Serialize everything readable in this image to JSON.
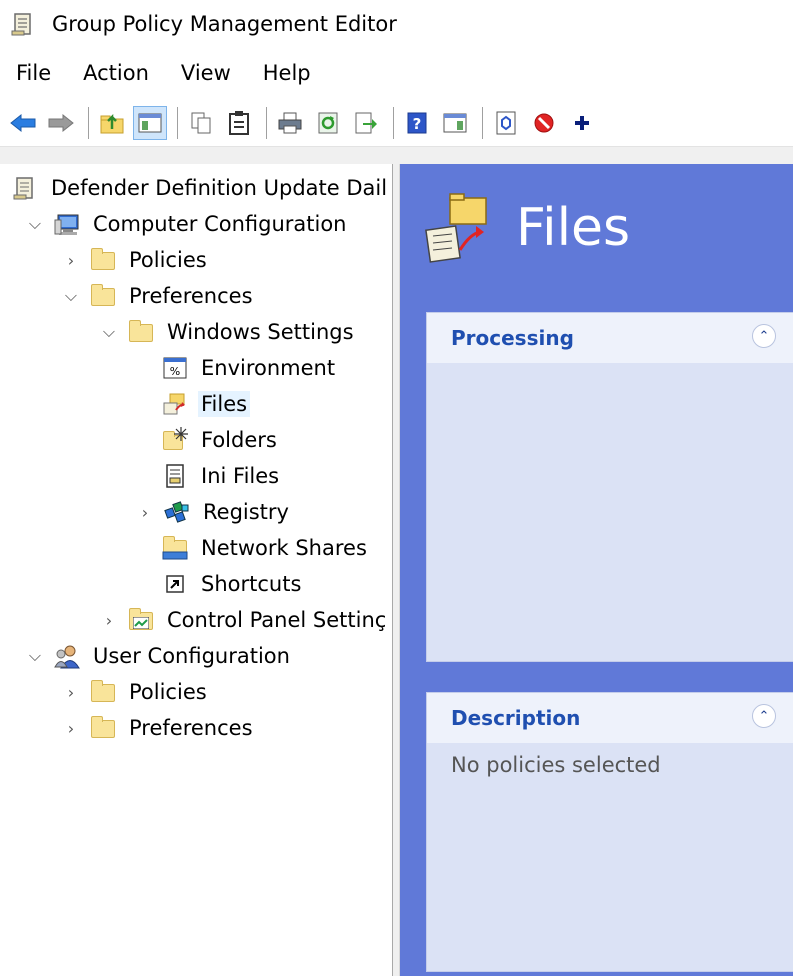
{
  "window": {
    "title": "Group Policy Management Editor"
  },
  "menu": {
    "items": [
      "File",
      "Action",
      "View",
      "Help"
    ]
  },
  "toolbar": {
    "buttons": [
      "back-icon",
      "forward-icon",
      "up-folder-icon",
      "show-hide-tree-icon",
      "copy-icon",
      "paste-icon",
      "print-icon",
      "refresh-icon",
      "export-list-icon",
      "help-icon",
      "show-hide-action-pane-icon",
      "properties-icon",
      "disable-icon",
      "add-icon"
    ]
  },
  "tree": {
    "items": [
      {
        "label": "Defender Definition Update Dail",
        "level": 0,
        "icon": "policy-scroll-icon",
        "expander": "none"
      },
      {
        "label": "Computer Configuration",
        "level": 1,
        "icon": "computer-icon",
        "expander": "expanded"
      },
      {
        "label": "Policies",
        "level": 2,
        "icon": "folder-icon",
        "expander": "collapsed"
      },
      {
        "label": "Preferences",
        "level": 2,
        "icon": "folder-icon",
        "expander": "expanded"
      },
      {
        "label": "Windows Settings",
        "level": 3,
        "icon": "folder-icon",
        "expander": "expanded"
      },
      {
        "label": "Environment",
        "level": 4,
        "icon": "environment-icon",
        "expander": "none"
      },
      {
        "label": "Files",
        "level": 4,
        "icon": "files-icon",
        "expander": "none",
        "selected": true
      },
      {
        "label": "Folders",
        "level": 4,
        "icon": "new-folder-icon",
        "expander": "none"
      },
      {
        "label": "Ini Files",
        "level": 4,
        "icon": "ini-file-icon",
        "expander": "none"
      },
      {
        "label": "Registry",
        "level": 4,
        "icon": "registry-icon",
        "expander": "collapsed"
      },
      {
        "label": "Network Shares",
        "level": 4,
        "icon": "network-share-icon",
        "expander": "none"
      },
      {
        "label": "Shortcuts",
        "level": 4,
        "icon": "shortcut-icon",
        "expander": "none"
      },
      {
        "label": "Control Panel Settinç",
        "level": 3,
        "icon": "control-panel-icon",
        "expander": "collapsed"
      },
      {
        "label": "User Configuration",
        "level": 1,
        "icon": "users-icon",
        "expander": "expanded"
      },
      {
        "label": "Policies",
        "level": 2,
        "icon": "folder-icon",
        "expander": "collapsed"
      },
      {
        "label": "Preferences",
        "level": 2,
        "icon": "folder-icon",
        "expander": "collapsed"
      }
    ]
  },
  "right_pane": {
    "title": "Files",
    "sections": [
      {
        "title": "Processing",
        "body": ""
      },
      {
        "title": "Description",
        "body": "No policies selected"
      }
    ]
  },
  "colors": {
    "pane_background": "#6079d8",
    "section_title": "#1f4fb0",
    "selection": "#e5f3ff"
  }
}
